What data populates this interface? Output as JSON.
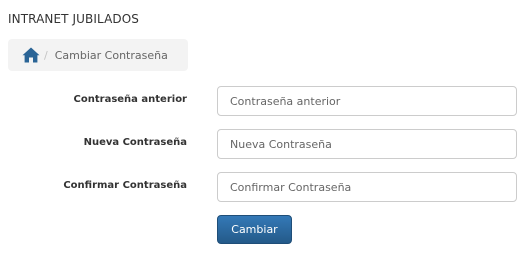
{
  "header": {
    "app_title": "INTRANET JUBILADOS"
  },
  "breadcrumb": {
    "home_icon": "home-icon",
    "separator": "/",
    "current": "Cambiar Contraseña"
  },
  "form": {
    "fields": [
      {
        "label": "Contraseña anterior",
        "placeholder": "Contraseña anterior",
        "value": ""
      },
      {
        "label": "Nueva Contraseña",
        "placeholder": "Nueva Contraseña",
        "value": ""
      },
      {
        "label": "Confirmar Contraseña",
        "placeholder": "Confirmar Contraseña",
        "value": ""
      }
    ],
    "submit_label": "Cambiar"
  },
  "colors": {
    "accent": "#2a6496",
    "breadcrumb_bg": "#f3f3f3"
  }
}
